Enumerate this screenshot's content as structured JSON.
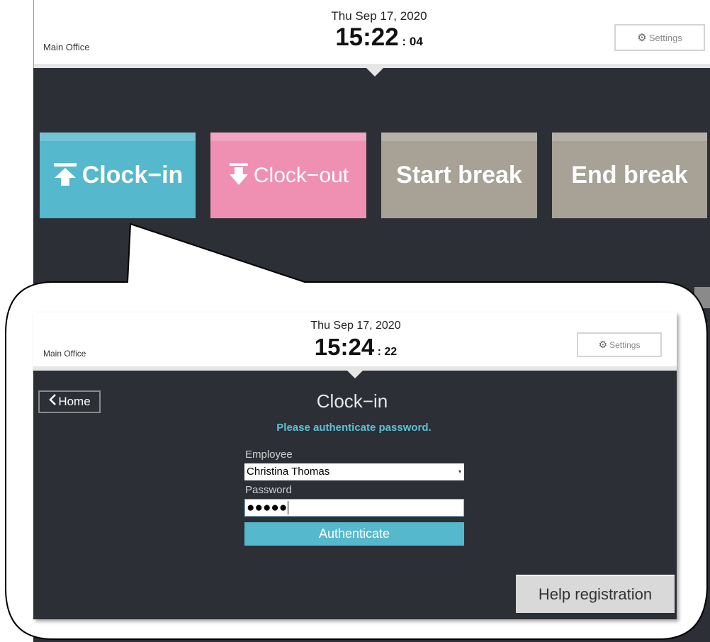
{
  "background_screen": {
    "office": "Main Office",
    "date": "Thu Sep 17, 2020",
    "time": "15:22",
    "seconds": "04",
    "settings_label": "Settings",
    "actions": {
      "clock_in": "Clock−in",
      "clock_out": "Clock−out",
      "start_break": "Start break",
      "end_break": "End break"
    },
    "colors": {
      "clock_in": "#55b8cc",
      "clock_out": "#ef90b2",
      "break": "#a7a196",
      "screen_bg": "#2c2f36"
    }
  },
  "detail_screen": {
    "office": "Main Office",
    "date": "Thu Sep 17, 2020",
    "time": "15:24",
    "seconds": "22",
    "settings_label": "Settings",
    "home_label": "Home",
    "title": "Clock−in",
    "subtitle": "Please authenticate password.",
    "employee_label": "Employee",
    "employee_value": "Christina Thomas",
    "password_label": "Password",
    "password_mask": "●●●●●",
    "authenticate_label": "Authenticate",
    "help_label": "Help registration",
    "colors": {
      "accent": "#55b8cc",
      "subtitle": "#5cc2d6"
    }
  },
  "icons": {
    "settings": "gear-icon",
    "clock_in": "upload-arrow-icon",
    "clock_out": "download-arrow-icon",
    "home": "chevron-left-icon"
  }
}
